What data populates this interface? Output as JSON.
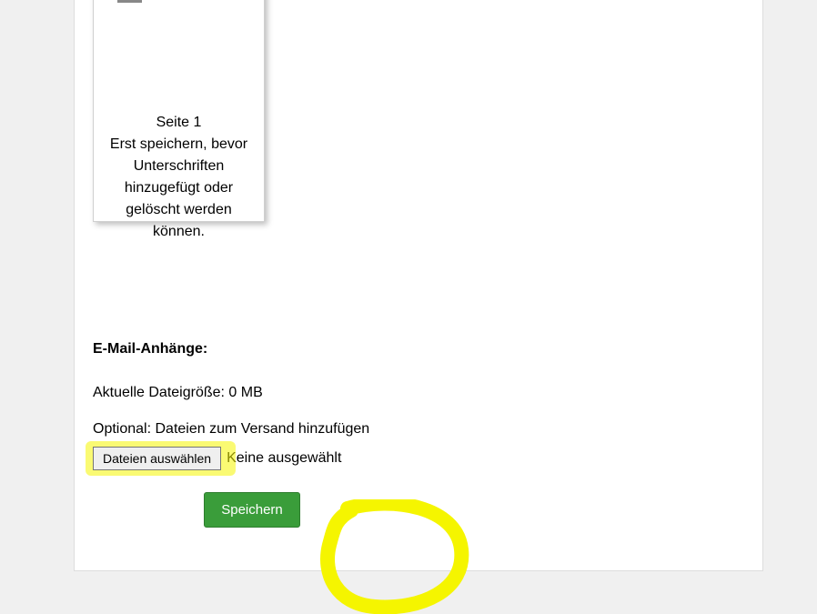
{
  "page_preview": {
    "page_label": "Seite 1",
    "note": "Erst speichern, bevor Unterschriften hinzugefügt oder gelöscht werden können."
  },
  "attachments": {
    "heading": "E-Mail-Anhänge:",
    "current_size_label": "Aktuelle Dateigröße: 0 MB",
    "optional_hint": "Optional: Dateien zum Versand hinzufügen",
    "choose_files_label": "Dateien auswählen",
    "none_selected_label": "Keine ausgewählt",
    "save_label": "Speichern"
  },
  "colors": {
    "highlight": "#f5f500",
    "save_bg": "#3a9d3a"
  }
}
